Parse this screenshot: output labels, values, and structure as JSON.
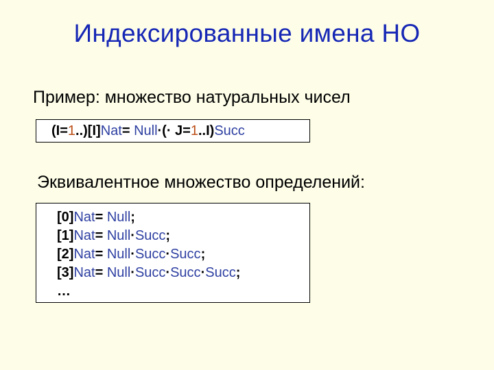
{
  "title": "Индексированные имена НО",
  "subtitle1": "Пример: множество натуральных чисел",
  "box1": {
    "p1_open": "(I=",
    "p1_one": "1",
    "p1_mid1": "..)[I]",
    "p1_nat": "Nat",
    "p1_eq": "= ",
    "p1_null": "Null",
    "p1_mid2": "·(· J=",
    "p1_one2": "1",
    "p1_mid3": "..I)",
    "p1_succ": "Succ"
  },
  "subtitle2": "Эквивалентное множество определений:",
  "box2": {
    "rows": [
      {
        "idx": "[0]",
        "nat": "Nat",
        "eq": "= ",
        "null": "Null",
        "rest": [],
        "semi": ";"
      },
      {
        "idx": "[1]",
        "nat": "Nat",
        "eq": "= ",
        "null": "Null",
        "rest": [
          "·",
          "Succ"
        ],
        "semi": ";"
      },
      {
        "idx": "[2]",
        "nat": "Nat",
        "eq": "= ",
        "null": "Null",
        "rest": [
          "·",
          "Succ",
          "·",
          "Succ"
        ],
        "semi": ";"
      },
      {
        "idx": "[3]",
        "nat": "Nat",
        "eq": "= ",
        "null": "Null",
        "rest": [
          "·",
          "Succ",
          "·",
          "Succ",
          "·",
          "Succ"
        ],
        "semi": ";"
      }
    ],
    "ellipsis": "…"
  }
}
